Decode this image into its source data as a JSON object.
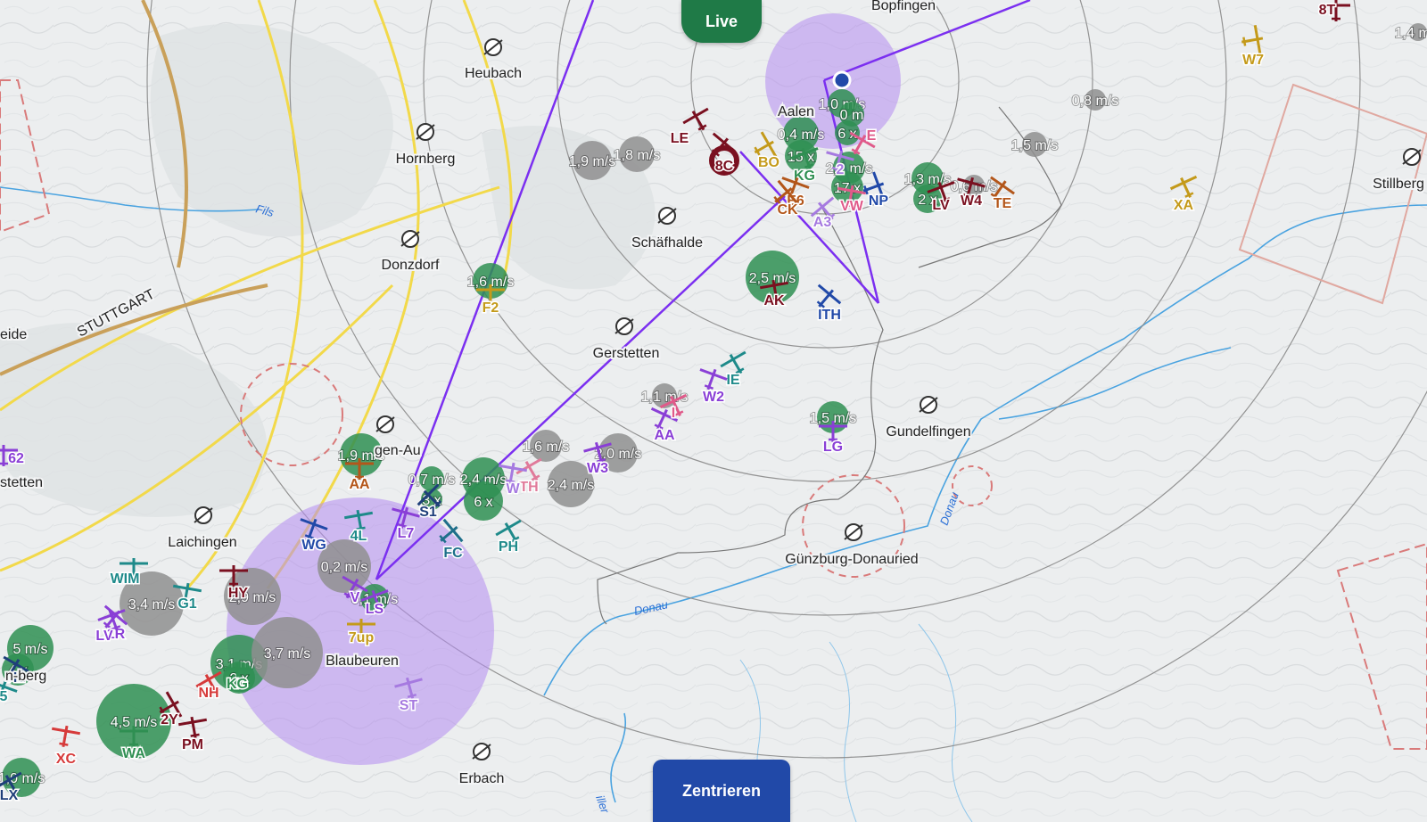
{
  "buttons": {
    "live_label": "Live",
    "center_label": "Zentrieren"
  },
  "colors": {
    "live_button": "#1f7a47",
    "center_button": "#2149a8",
    "track_line": "#7b2ff0",
    "thermal_circle": "#b58cf0",
    "range_ring": "#888888",
    "airspace_yellow": "#f2d94a",
    "airspace_brown": "#c9a05a",
    "restricted_red": "#d97a7a",
    "river": "#4aa3e0",
    "climb_green": "#2f8f52",
    "climb_gray": "#8f8f8f",
    "own_position": "#2149a8"
  },
  "towns": [
    {
      "name": "Bopfingen"
    },
    {
      "name": "Heubach"
    },
    {
      "name": "Hornberg"
    },
    {
      "name": "Donzdorf"
    },
    {
      "name": "Schäfhalde"
    },
    {
      "name": "Gerstetten"
    },
    {
      "name": "Gundelfingen"
    },
    {
      "name": "Günzburg-Donauried"
    },
    {
      "name": "Laichingen"
    },
    {
      "name": "Blaubeuren"
    },
    {
      "name": "Erbach"
    },
    {
      "name": "Stillberg"
    },
    {
      "name": "eide"
    },
    {
      "name": "stetten"
    },
    {
      "name": "Aalen"
    },
    {
      "name": "gen-Au"
    },
    {
      "name": "n-berg"
    }
  ],
  "map_labels": [
    "STUTTGART",
    "Fils",
    "Donau",
    "Donau",
    "iller"
  ],
  "thermals": [
    {
      "label": "1,0 m/s",
      "kind": "green"
    },
    {
      "label": "0,4 m/s",
      "kind": "green"
    },
    {
      "label": "15 x",
      "kind": "green"
    },
    {
      "label": "2,1 m/s",
      "kind": "green"
    },
    {
      "label": "17 x",
      "kind": "green"
    },
    {
      "label": "1,3 m/s",
      "kind": "green"
    },
    {
      "label": "2 x",
      "kind": "green"
    },
    {
      "label": "0,6 m/s",
      "kind": "gray"
    },
    {
      "label": "1,5 m/s",
      "kind": "gray"
    },
    {
      "label": "0,8 m/s",
      "kind": "gray"
    },
    {
      "label": "1,4 m/s",
      "kind": "gray"
    },
    {
      "label": "1,9 m/s",
      "kind": "gray"
    },
    {
      "label": "1,8 m/s",
      "kind": "gray"
    },
    {
      "label": "1,6 m/s",
      "kind": "green"
    },
    {
      "label": "2,5 m/s",
      "kind": "green"
    },
    {
      "label": "1,1 m/s",
      "kind": "gray"
    },
    {
      "label": "1,5 m/s",
      "kind": "green"
    },
    {
      "label": "1,6 m/s",
      "kind": "gray"
    },
    {
      "label": "2,0 m/s",
      "kind": "gray"
    },
    {
      "label": "2,4 m/s",
      "kind": "gray"
    },
    {
      "label": "1,9 m/s",
      "kind": "green"
    },
    {
      "label": "0,7 m/s",
      "kind": "green"
    },
    {
      "label": "3 x",
      "kind": "green"
    },
    {
      "label": "2,4 m/s",
      "kind": "green"
    },
    {
      "label": "6 x",
      "kind": "green"
    },
    {
      "label": "0,2 m/s",
      "kind": "gray"
    },
    {
      "label": "0,1 m/s",
      "kind": "green"
    },
    {
      "label": "3,4 m/s",
      "kind": "gray"
    },
    {
      "label": "2,9 m/s",
      "kind": "gray"
    },
    {
      "label": "3,1 m/s",
      "kind": "green"
    },
    {
      "label": "2 x",
      "kind": "green"
    },
    {
      "label": "3,7 m/s",
      "kind": "gray"
    },
    {
      "label": "5 m/s",
      "kind": "green"
    },
    {
      "label": "4 x",
      "kind": "green"
    },
    {
      "label": "4,5 m/s",
      "kind": "green"
    },
    {
      "label": "1,0 m/s",
      "kind": "green"
    },
    {
      "label": "0 m",
      "kind": "green"
    },
    {
      "label": "6 x",
      "kind": "green"
    }
  ],
  "gliders": [
    {
      "callsign": "8T",
      "color": "#7a1020"
    },
    {
      "callsign": "W7",
      "color": "#c49a1a"
    },
    {
      "callsign": "LE",
      "color": "#7a1020"
    },
    {
      "callsign": "8C",
      "color": "#7a1020"
    },
    {
      "callsign": "BO",
      "color": "#c49a1a"
    },
    {
      "callsign": "KG",
      "color": "#2f8f52"
    },
    {
      "callsign": "E6",
      "color": "#b3561a"
    },
    {
      "callsign": "CK",
      "color": "#b3561a"
    },
    {
      "callsign": "A3",
      "color": "#a67ae0"
    },
    {
      "callsign": "VW",
      "color": "#e05a8a"
    },
    {
      "callsign": "NP",
      "color": "#2149a8"
    },
    {
      "callsign": "E",
      "color": "#e05a8a"
    },
    {
      "callsign": "LV",
      "color": "#7a1020"
    },
    {
      "callsign": "W4",
      "color": "#7a1020"
    },
    {
      "callsign": "TE",
      "color": "#b3561a"
    },
    {
      "callsign": "XA",
      "color": "#c49a1a"
    },
    {
      "callsign": "F2",
      "color": "#c49a1a"
    },
    {
      "callsign": "AK",
      "color": "#7a1020"
    },
    {
      "callsign": "ITH",
      "color": "#2149a8"
    },
    {
      "callsign": "IE",
      "color": "#1e8a8a"
    },
    {
      "callsign": "W2",
      "color": "#8a3fd6"
    },
    {
      "callsign": "AA",
      "color": "#8a3fd6"
    },
    {
      "callsign": "W3",
      "color": "#8a3fd6"
    },
    {
      "callsign": "LG",
      "color": "#8a3fd6"
    },
    {
      "callsign": "TH",
      "color": "#e07a9a"
    },
    {
      "callsign": "W",
      "color": "#a67ae0"
    },
    {
      "callsign": "AA",
      "color": "#b3561a"
    },
    {
      "callsign": "S1",
      "color": "#1f3f7a"
    },
    {
      "callsign": "L7",
      "color": "#8a3fd6"
    },
    {
      "callsign": "FC",
      "color": "#1e6f8a"
    },
    {
      "callsign": "PH",
      "color": "#1e8a8a"
    },
    {
      "callsign": "WG",
      "color": "#2149a8"
    },
    {
      "callsign": "4L",
      "color": "#1e8a8a"
    },
    {
      "callsign": "V",
      "color": "#8a3fd6"
    },
    {
      "callsign": "LS",
      "color": "#8a3fd6"
    },
    {
      "callsign": "7up",
      "color": "#c49a1a"
    },
    {
      "callsign": "ST",
      "color": "#a67ae0"
    },
    {
      "callsign": "WIM",
      "color": "#1e8a8a"
    },
    {
      "callsign": "1R",
      "color": "#8a3fd6"
    },
    {
      "callsign": "LV",
      "color": "#8a3fd6"
    },
    {
      "callsign": "G1",
      "color": "#1e8a8a"
    },
    {
      "callsign": "HY",
      "color": "#7a1020"
    },
    {
      "callsign": "KG",
      "color": "#2f8f52"
    },
    {
      "callsign": "NH",
      "color": "#d63a3a"
    },
    {
      "callsign": "2Y",
      "color": "#7a1020"
    },
    {
      "callsign": "PM",
      "color": "#7a1020"
    },
    {
      "callsign": "WA",
      "color": "#2f8f52"
    },
    {
      "callsign": "XC",
      "color": "#d63a3a"
    },
    {
      "callsign": "LX",
      "color": "#1f3f7a"
    },
    {
      "callsign": "H2",
      "color": "#1f3f7a"
    },
    {
      "callsign": "62",
      "color": "#8a3fd6"
    },
    {
      "callsign": "5",
      "color": "#1e8a8a"
    },
    {
      "callsign": "I",
      "color": "#e05a8a"
    },
    {
      "callsign": "2",
      "color": "#a67ae0"
    }
  ]
}
